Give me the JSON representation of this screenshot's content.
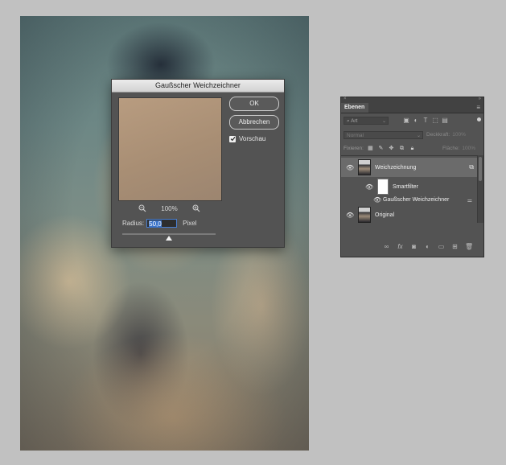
{
  "dialog": {
    "title": "Gaußscher Weichzeichner",
    "ok_label": "OK",
    "cancel_label": "Abbrechen",
    "preview_label": "Vorschau",
    "preview_checked": true,
    "zoom_level": "100%",
    "radius_label": "Radius:",
    "radius_value": "50,0",
    "radius_unit": "Pixel",
    "slider_fraction": 0.5
  },
  "layers_panel": {
    "tab_label": "Ebenen",
    "filter_kind": "Art",
    "blend_mode": "Normal",
    "opacity_label": "Deckkraft:",
    "opacity_value": "100%",
    "lock_label": "Fixieren:",
    "fill_label": "Fläche:",
    "fill_value": "100%",
    "layers": [
      {
        "name": "Weichzeichnung",
        "selected": true,
        "type": "smart-object"
      },
      {
        "name": "Smartfilter",
        "type": "filter-mask"
      },
      {
        "name": "Gaußscher Weichzeichner",
        "type": "filter"
      },
      {
        "name": "Original",
        "type": "pixel"
      }
    ]
  },
  "colors": {
    "app_background": "#c1c1c1",
    "panel_background": "#535353",
    "selected_layer": "#6b6b6b",
    "selection_highlight": "#3b73c9"
  }
}
